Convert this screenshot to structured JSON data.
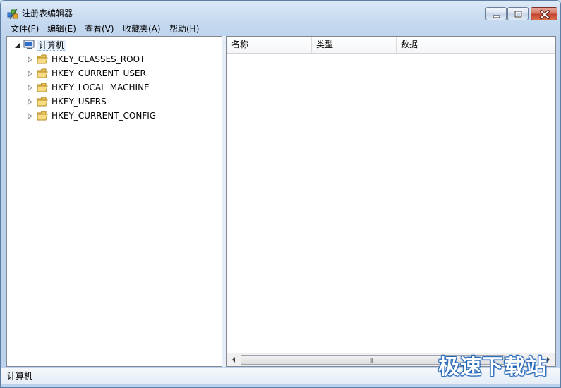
{
  "window": {
    "title": "注册表编辑器"
  },
  "menu": [
    {
      "label": "文件(F)"
    },
    {
      "label": "编辑(E)"
    },
    {
      "label": "查看(V)"
    },
    {
      "label": "收藏夹(A)"
    },
    {
      "label": "帮助(H)"
    }
  ],
  "tree": {
    "root_label": "计算机",
    "root_icon": "computer-icon",
    "items": [
      {
        "label": "HKEY_CLASSES_ROOT",
        "icon": "folder-icon"
      },
      {
        "label": "HKEY_CURRENT_USER",
        "icon": "folder-icon"
      },
      {
        "label": "HKEY_LOCAL_MACHINE",
        "icon": "folder-icon"
      },
      {
        "label": "HKEY_USERS",
        "icon": "folder-icon"
      },
      {
        "label": "HKEY_CURRENT_CONFIG",
        "icon": "folder-icon"
      }
    ]
  },
  "list": {
    "columns": [
      {
        "label": "名称"
      },
      {
        "label": "类型"
      },
      {
        "label": "数据"
      }
    ],
    "rows": []
  },
  "status": {
    "path": "计算机"
  },
  "watermark": {
    "text": "极速下载站"
  },
  "colors": {
    "close_button": "#c1412b",
    "title_gradient": "#c5d9f0",
    "selection": "#e6f0fb"
  }
}
